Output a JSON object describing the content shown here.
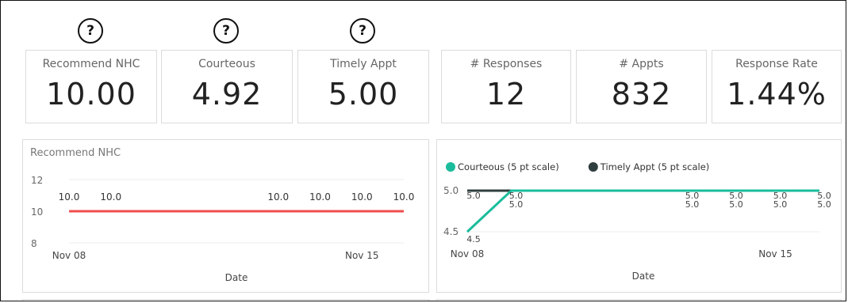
{
  "help_icons": [
    "?",
    "?",
    "?"
  ],
  "kpis": [
    {
      "label": "Recommend NHC",
      "value": "10.00"
    },
    {
      "label": "Courteous",
      "value": "4.92"
    },
    {
      "label": "Timely Appt",
      "value": "5.00"
    },
    {
      "label": "# Responses",
      "value": "12"
    },
    {
      "label": "# Appts",
      "value": "832"
    },
    {
      "label": "Response Rate",
      "value": "1.44%"
    }
  ],
  "chart_data": [
    {
      "type": "line",
      "title": "Recommend NHC",
      "xlabel": "Date",
      "ylabel": "",
      "x_ticks": [
        "Nov 08",
        "Nov 15"
      ],
      "y_ticks": [
        "8",
        "10",
        "12"
      ],
      "ylim": [
        8,
        12
      ],
      "x": [
        "Nov 08",
        "Nov 09",
        "Nov 13",
        "Nov 14",
        "Nov 15",
        "Nov 16"
      ],
      "series": [
        {
          "values": [
            10.0,
            10.0,
            10.0,
            10.0,
            10.0,
            10.0
          ],
          "labels": [
            "10.0",
            "10.0",
            "10.0",
            "10.0",
            "10.0",
            "10.0"
          ],
          "color": "#f04e4e"
        }
      ],
      "grid": "horizontal",
      "legend": "none"
    },
    {
      "type": "line",
      "title": "",
      "xlabel": "Date",
      "ylabel": "",
      "x_ticks": [
        "Nov 08",
        "Nov 15"
      ],
      "y_ticks": [
        "4.5",
        "5.0"
      ],
      "ylim": [
        4.5,
        5.0
      ],
      "x": [
        "Nov 08",
        "Nov 09",
        "Nov 13",
        "Nov 14",
        "Nov 15",
        "Nov 16"
      ],
      "series": [
        {
          "name": "Courteous (5 pt scale)",
          "values": [
            4.5,
            5.0,
            5.0,
            5.0,
            5.0,
            5.0
          ],
          "labels": [
            "4.5",
            "5.0",
            "5.0",
            "5.0",
            "5.0",
            "5.0"
          ],
          "color": "#1abc9c"
        },
        {
          "name": "Timely Appt (5 pt scale)",
          "values": [
            5.0,
            5.0,
            5.0,
            5.0,
            5.0,
            5.0
          ],
          "labels": [
            "5.0",
            "5.0",
            "5.0",
            "5.0",
            "5.0",
            "5.0"
          ],
          "color": "#2f3e3e"
        }
      ],
      "grid": "horizontal",
      "legend": "top-left"
    }
  ]
}
